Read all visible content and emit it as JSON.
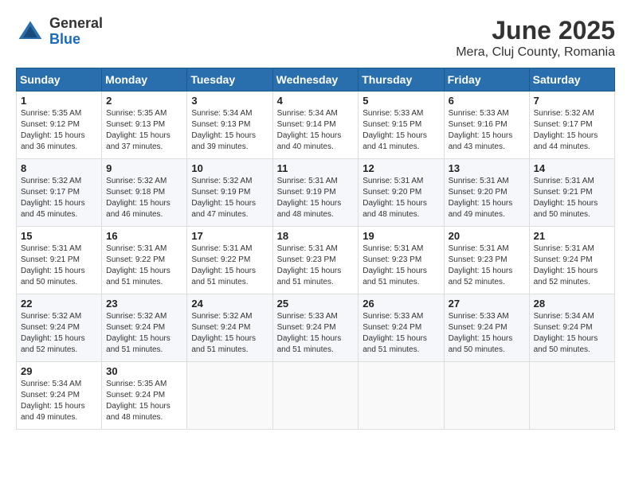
{
  "logo": {
    "general": "General",
    "blue": "Blue"
  },
  "title": "June 2025",
  "subtitle": "Mera, Cluj County, Romania",
  "days_header": [
    "Sunday",
    "Monday",
    "Tuesday",
    "Wednesday",
    "Thursday",
    "Friday",
    "Saturday"
  ],
  "weeks": [
    [
      {
        "day": "1",
        "info": "Sunrise: 5:35 AM\nSunset: 9:12 PM\nDaylight: 15 hours\nand 36 minutes."
      },
      {
        "day": "2",
        "info": "Sunrise: 5:35 AM\nSunset: 9:13 PM\nDaylight: 15 hours\nand 37 minutes."
      },
      {
        "day": "3",
        "info": "Sunrise: 5:34 AM\nSunset: 9:13 PM\nDaylight: 15 hours\nand 39 minutes."
      },
      {
        "day": "4",
        "info": "Sunrise: 5:34 AM\nSunset: 9:14 PM\nDaylight: 15 hours\nand 40 minutes."
      },
      {
        "day": "5",
        "info": "Sunrise: 5:33 AM\nSunset: 9:15 PM\nDaylight: 15 hours\nand 41 minutes."
      },
      {
        "day": "6",
        "info": "Sunrise: 5:33 AM\nSunset: 9:16 PM\nDaylight: 15 hours\nand 43 minutes."
      },
      {
        "day": "7",
        "info": "Sunrise: 5:32 AM\nSunset: 9:17 PM\nDaylight: 15 hours\nand 44 minutes."
      }
    ],
    [
      {
        "day": "8",
        "info": "Sunrise: 5:32 AM\nSunset: 9:17 PM\nDaylight: 15 hours\nand 45 minutes."
      },
      {
        "day": "9",
        "info": "Sunrise: 5:32 AM\nSunset: 9:18 PM\nDaylight: 15 hours\nand 46 minutes."
      },
      {
        "day": "10",
        "info": "Sunrise: 5:32 AM\nSunset: 9:19 PM\nDaylight: 15 hours\nand 47 minutes."
      },
      {
        "day": "11",
        "info": "Sunrise: 5:31 AM\nSunset: 9:19 PM\nDaylight: 15 hours\nand 48 minutes."
      },
      {
        "day": "12",
        "info": "Sunrise: 5:31 AM\nSunset: 9:20 PM\nDaylight: 15 hours\nand 48 minutes."
      },
      {
        "day": "13",
        "info": "Sunrise: 5:31 AM\nSunset: 9:20 PM\nDaylight: 15 hours\nand 49 minutes."
      },
      {
        "day": "14",
        "info": "Sunrise: 5:31 AM\nSunset: 9:21 PM\nDaylight: 15 hours\nand 50 minutes."
      }
    ],
    [
      {
        "day": "15",
        "info": "Sunrise: 5:31 AM\nSunset: 9:21 PM\nDaylight: 15 hours\nand 50 minutes."
      },
      {
        "day": "16",
        "info": "Sunrise: 5:31 AM\nSunset: 9:22 PM\nDaylight: 15 hours\nand 51 minutes."
      },
      {
        "day": "17",
        "info": "Sunrise: 5:31 AM\nSunset: 9:22 PM\nDaylight: 15 hours\nand 51 minutes."
      },
      {
        "day": "18",
        "info": "Sunrise: 5:31 AM\nSunset: 9:23 PM\nDaylight: 15 hours\nand 51 minutes."
      },
      {
        "day": "19",
        "info": "Sunrise: 5:31 AM\nSunset: 9:23 PM\nDaylight: 15 hours\nand 51 minutes."
      },
      {
        "day": "20",
        "info": "Sunrise: 5:31 AM\nSunset: 9:23 PM\nDaylight: 15 hours\nand 52 minutes."
      },
      {
        "day": "21",
        "info": "Sunrise: 5:31 AM\nSunset: 9:24 PM\nDaylight: 15 hours\nand 52 minutes."
      }
    ],
    [
      {
        "day": "22",
        "info": "Sunrise: 5:32 AM\nSunset: 9:24 PM\nDaylight: 15 hours\nand 52 minutes."
      },
      {
        "day": "23",
        "info": "Sunrise: 5:32 AM\nSunset: 9:24 PM\nDaylight: 15 hours\nand 51 minutes."
      },
      {
        "day": "24",
        "info": "Sunrise: 5:32 AM\nSunset: 9:24 PM\nDaylight: 15 hours\nand 51 minutes."
      },
      {
        "day": "25",
        "info": "Sunrise: 5:33 AM\nSunset: 9:24 PM\nDaylight: 15 hours\nand 51 minutes."
      },
      {
        "day": "26",
        "info": "Sunrise: 5:33 AM\nSunset: 9:24 PM\nDaylight: 15 hours\nand 51 minutes."
      },
      {
        "day": "27",
        "info": "Sunrise: 5:33 AM\nSunset: 9:24 PM\nDaylight: 15 hours\nand 50 minutes."
      },
      {
        "day": "28",
        "info": "Sunrise: 5:34 AM\nSunset: 9:24 PM\nDaylight: 15 hours\nand 50 minutes."
      }
    ],
    [
      {
        "day": "29",
        "info": "Sunrise: 5:34 AM\nSunset: 9:24 PM\nDaylight: 15 hours\nand 49 minutes."
      },
      {
        "day": "30",
        "info": "Sunrise: 5:35 AM\nSunset: 9:24 PM\nDaylight: 15 hours\nand 48 minutes."
      },
      null,
      null,
      null,
      null,
      null
    ]
  ]
}
